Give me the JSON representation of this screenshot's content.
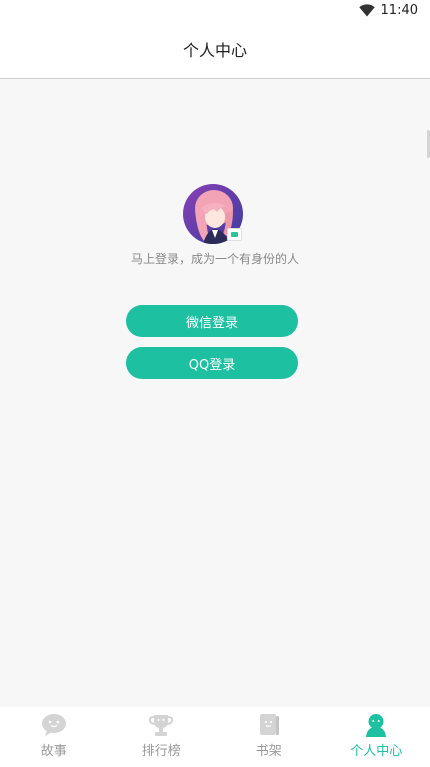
{
  "status_bar": {
    "time": "11:40",
    "wifi_icon": "wifi-icon"
  },
  "header": {
    "title": "个人中心"
  },
  "profile": {
    "avatar_icon": "avatar-image",
    "prompt": "马上登录，成为一个有身份的人"
  },
  "login": {
    "wechat_label": "微信登录",
    "qq_label": "QQ登录"
  },
  "nav": {
    "items": [
      {
        "label": "故事",
        "icon": "chat-bubble-icon",
        "active": false
      },
      {
        "label": "排行榜",
        "icon": "trophy-icon",
        "active": false
      },
      {
        "label": "书架",
        "icon": "book-icon",
        "active": false
      },
      {
        "label": "个人中心",
        "icon": "person-icon",
        "active": true
      }
    ]
  },
  "colors": {
    "accent": "#1dc0a0",
    "inactive": "#9a9a9a",
    "background": "#f7f7f7"
  }
}
